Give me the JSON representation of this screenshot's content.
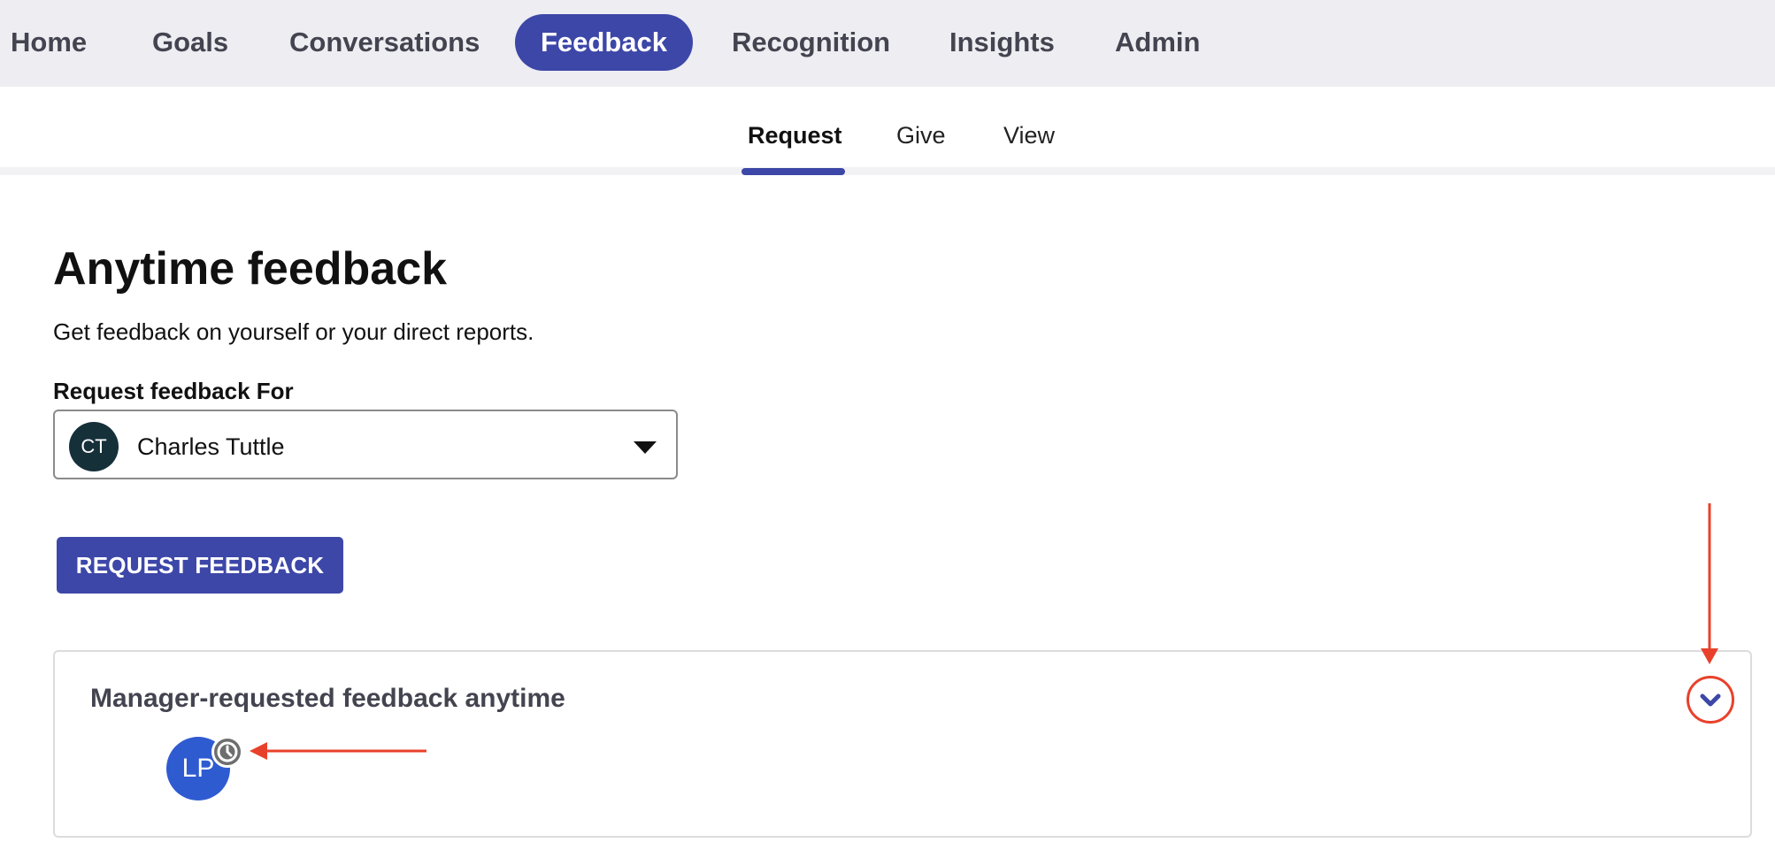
{
  "top_nav": {
    "items": [
      {
        "label": "Home",
        "active": false
      },
      {
        "label": "Goals",
        "active": false
      },
      {
        "label": "Conversations",
        "active": false
      },
      {
        "label": "Feedback",
        "active": true
      },
      {
        "label": "Recognition",
        "active": false
      },
      {
        "label": "Insights",
        "active": false
      },
      {
        "label": "Admin",
        "active": false
      }
    ]
  },
  "sub_tabs": {
    "items": [
      {
        "label": "Request",
        "active": true
      },
      {
        "label": "Give",
        "active": false
      },
      {
        "label": "View",
        "active": false
      }
    ]
  },
  "main": {
    "title": "Anytime feedback",
    "subtitle": "Get feedback on yourself or your direct reports.",
    "request_for": {
      "label": "Request feedback For",
      "selected_initials": "CT",
      "selected_name": "Charles Tuttle",
      "icon": "caret-down-icon"
    },
    "request_button_label": "REQUEST FEEDBACK"
  },
  "panel": {
    "title": "Manager-requested feedback anytime",
    "avatar_initials": "LP",
    "badge_icon": "clock-icon",
    "toggle_icon": "chevron-down-icon"
  },
  "colors": {
    "accent": "#3d47a8",
    "nav_background": "#ededf2",
    "annotation": "#e8412b",
    "avatar_ct": "#16303a",
    "avatar_lp": "#2f5bd1"
  }
}
